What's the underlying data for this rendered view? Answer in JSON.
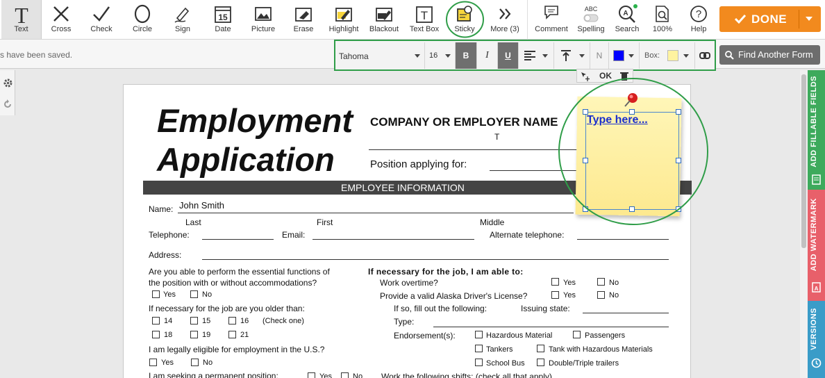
{
  "toolbar": {
    "tools": [
      {
        "icon": "text-icon",
        "label": "Text"
      },
      {
        "icon": "cross-icon",
        "label": "Cross"
      },
      {
        "icon": "check-icon",
        "label": "Check"
      },
      {
        "icon": "circle-icon",
        "label": "Circle"
      },
      {
        "icon": "sign-icon",
        "label": "Sign"
      },
      {
        "icon": "date-icon",
        "label": "Date",
        "date_num": "15"
      },
      {
        "icon": "picture-icon",
        "label": "Picture"
      },
      {
        "icon": "erase-icon",
        "label": "Erase"
      },
      {
        "icon": "highlight-icon",
        "label": "Highlight"
      },
      {
        "icon": "blackout-icon",
        "label": "Blackout"
      },
      {
        "icon": "textbox-icon",
        "label": "Text Box",
        "glyph": "T"
      },
      {
        "icon": "sticky-icon",
        "label": "Sticky"
      },
      {
        "icon": "more-icon",
        "label": "More (3)"
      },
      {
        "icon": "comment-icon",
        "label": "Comment"
      },
      {
        "icon": "spelling-icon",
        "label": "Spelling",
        "abc": "ABC"
      },
      {
        "icon": "search-icon",
        "label": "Search"
      },
      {
        "icon": "zoom-icon",
        "label": "100%"
      },
      {
        "icon": "help-icon",
        "label": "Help",
        "glyph": "?"
      }
    ],
    "done_label": "DONE",
    "accent": "#f28a1e"
  },
  "format_bar": {
    "status": "s have been saved.",
    "font": "Tahoma",
    "size": "16",
    "bold": "B",
    "italic": "I",
    "underline": "U",
    "normal": "N",
    "box_label": "Box:",
    "text_color": "#0000ff",
    "box_color": "#fff3a0",
    "find_label": "Find Another Form"
  },
  "side_tabs": [
    {
      "label": "ADD FILLABLE FIELDS",
      "color": "#3daa5c"
    },
    {
      "label": "ADD WATERMARK",
      "color": "#e8606a"
    },
    {
      "label": "VERSIONS",
      "color": "#3a9cc8"
    }
  ],
  "sticky": {
    "ok": "OK",
    "text": "Type here..."
  },
  "doc": {
    "title1": "Employment",
    "title2": "Application",
    "company": "COMPANY OR EMPLOYER NAME",
    "company_input": "T",
    "position": "Position applying for:",
    "band": "EMPLOYEE INFORMATION",
    "name_label": "Name:",
    "name_value": "John Smith",
    "last": "Last",
    "first": "First",
    "middle": "Middle",
    "telephone": "Telephone:",
    "email": "Email:",
    "alt_phone": "Alternate telephone:",
    "address": "Address:",
    "q1a": "Are you able to perform the essential functions of",
    "q1b": "the position with or without accommodations?",
    "yes": "Yes",
    "no": "No",
    "q2": "If necessary for the job are you older than:",
    "ages": [
      "14",
      "15",
      "16",
      "18",
      "19",
      "21"
    ],
    "check_one": "(Check one)",
    "q3": "I am legally eligible for employment in the U.S.?",
    "q4": "I am seeking a permanent position:",
    "r_head": "If necessary for the job, I am able to:",
    "overtime": "Work overtime?",
    "license": "Provide a valid Alaska Driver's License?",
    "fill": "If so, fill out the following:",
    "issuing": "Issuing state:",
    "type": "Type:",
    "endorse": "Endorsement(s):",
    "endorsements": [
      "Hazardous Material",
      "Passengers",
      "Tankers",
      "Tank with Hazardous Materials",
      "School Bus",
      "Double/Triple trailers"
    ],
    "shifts": "Work the following shifts: (check all that apply)"
  }
}
